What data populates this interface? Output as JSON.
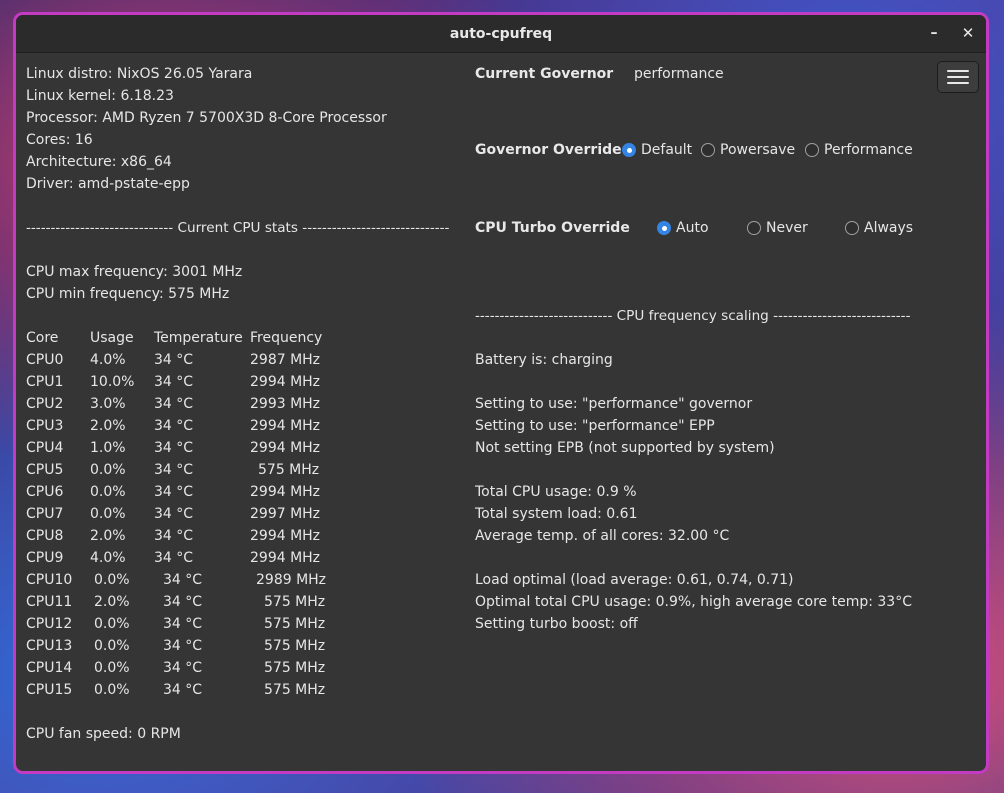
{
  "window": {
    "title": "auto-cpufreq"
  },
  "titlebar": {
    "minimize": "–",
    "close": "✕"
  },
  "sysinfo": [
    "Linux distro: NixOS 26.05 Yarara",
    "Linux kernel: 6.18.23",
    "Processor: AMD Ryzen 7 5700X3D 8-Core Processor",
    "Cores: 16",
    "Architecture: x86_64",
    "Driver: amd-pstate-epp"
  ],
  "cpu_stats_header": "------------------------------ Current CPU stats ------------------------------",
  "cpu_freq": {
    "max": "CPU max frequency: 3001 MHz",
    "min": "CPU min frequency: 575 MHz"
  },
  "table": {
    "headers": [
      "Core",
      "Usage",
      "Temperature",
      "Frequency"
    ],
    "rows": [
      [
        "CPU0",
        "4.0%",
        "34 °C",
        "2987 MHz"
      ],
      [
        "CPU1",
        "10.0%",
        "34 °C",
        "2994 MHz"
      ],
      [
        "CPU2",
        "3.0%",
        "34 °C",
        "2993 MHz"
      ],
      [
        "CPU3",
        "2.0%",
        "34 °C",
        "2994 MHz"
      ],
      [
        "CPU4",
        "1.0%",
        "34 °C",
        "2994 MHz"
      ],
      [
        "CPU5",
        "0.0%",
        "34 °C",
        "575 MHz"
      ],
      [
        "CPU6",
        "0.0%",
        "34 °C",
        "2994 MHz"
      ],
      [
        "CPU7",
        "0.0%",
        "34 °C",
        "2997 MHz"
      ],
      [
        "CPU8",
        "2.0%",
        "34 °C",
        "2994 MHz"
      ],
      [
        "CPU9",
        "4.0%",
        "34 °C",
        "2994 MHz"
      ],
      [
        "CPU10",
        "0.0%",
        "34 °C",
        "2989 MHz"
      ],
      [
        "CPU11",
        "2.0%",
        "34 °C",
        "575 MHz"
      ],
      [
        "CPU12",
        "0.0%",
        "34 °C",
        "575 MHz"
      ],
      [
        "CPU13",
        "0.0%",
        "34 °C",
        "575 MHz"
      ],
      [
        "CPU14",
        "0.0%",
        "34 °C",
        "575 MHz"
      ],
      [
        "CPU15",
        "0.0%",
        "34 °C",
        "575 MHz"
      ]
    ]
  },
  "fan_speed": "CPU fan speed: 0 RPM",
  "governor": {
    "label": "Current Governor",
    "value": "performance"
  },
  "governor_override": {
    "label": "Governor Override",
    "options": [
      "Default",
      "Powersave",
      "Performance"
    ],
    "selected": "Default"
  },
  "turbo_override": {
    "label": "CPU Turbo Override",
    "options": [
      "Auto",
      "Never",
      "Always"
    ],
    "selected": "Auto"
  },
  "scaling_header": "---------------------------- CPU frequency scaling ----------------------------",
  "scaling": {
    "battery": "Battery is: charging",
    "settings": [
      "Setting to use: \"performance\" governor",
      "Setting to use: \"performance\" EPP",
      "Not setting EPB (not supported by system)"
    ],
    "usage": [
      "Total CPU usage: 0.9 %",
      "Total system load: 0.61",
      "Average temp. of all cores: 32.00 °C"
    ],
    "load": [
      "Load optimal (load average: 0.61, 0.74, 0.71)",
      "Optimal total CPU usage: 0.9%, high average core temp: 33°C",
      "Setting turbo boost: off"
    ]
  },
  "colors": {
    "accent": "#3584e4",
    "window_border": "#c23bc2",
    "window_bg": "#353535"
  }
}
